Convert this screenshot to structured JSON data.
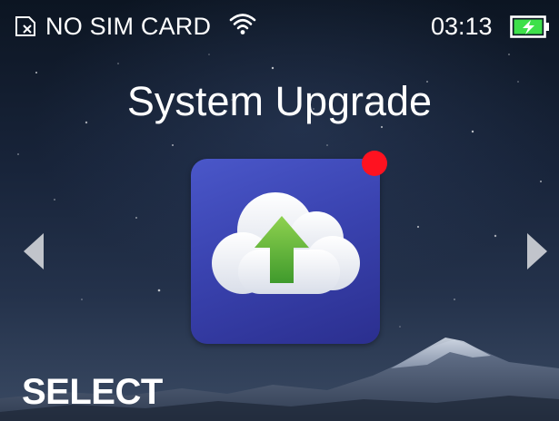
{
  "status_bar": {
    "sim_status": "NO SIM CARD",
    "time": "03:13",
    "sim_icon": "sim-card-off-icon",
    "wifi_icon": "wifi-icon",
    "battery_icon": "battery-charging-icon"
  },
  "screen": {
    "title": "System Upgrade",
    "app_icon": "cloud-upload-icon",
    "has_notification_dot": true
  },
  "navigation": {
    "left_icon": "chevron-left-icon",
    "right_icon": "chevron-right-icon"
  },
  "softkey": {
    "left_label": "SELECT"
  },
  "colors": {
    "tile": "#3a43b0",
    "notification_dot": "#ff1220",
    "arrow_green": "#5fb036",
    "battery_green": "#3ee04a"
  }
}
